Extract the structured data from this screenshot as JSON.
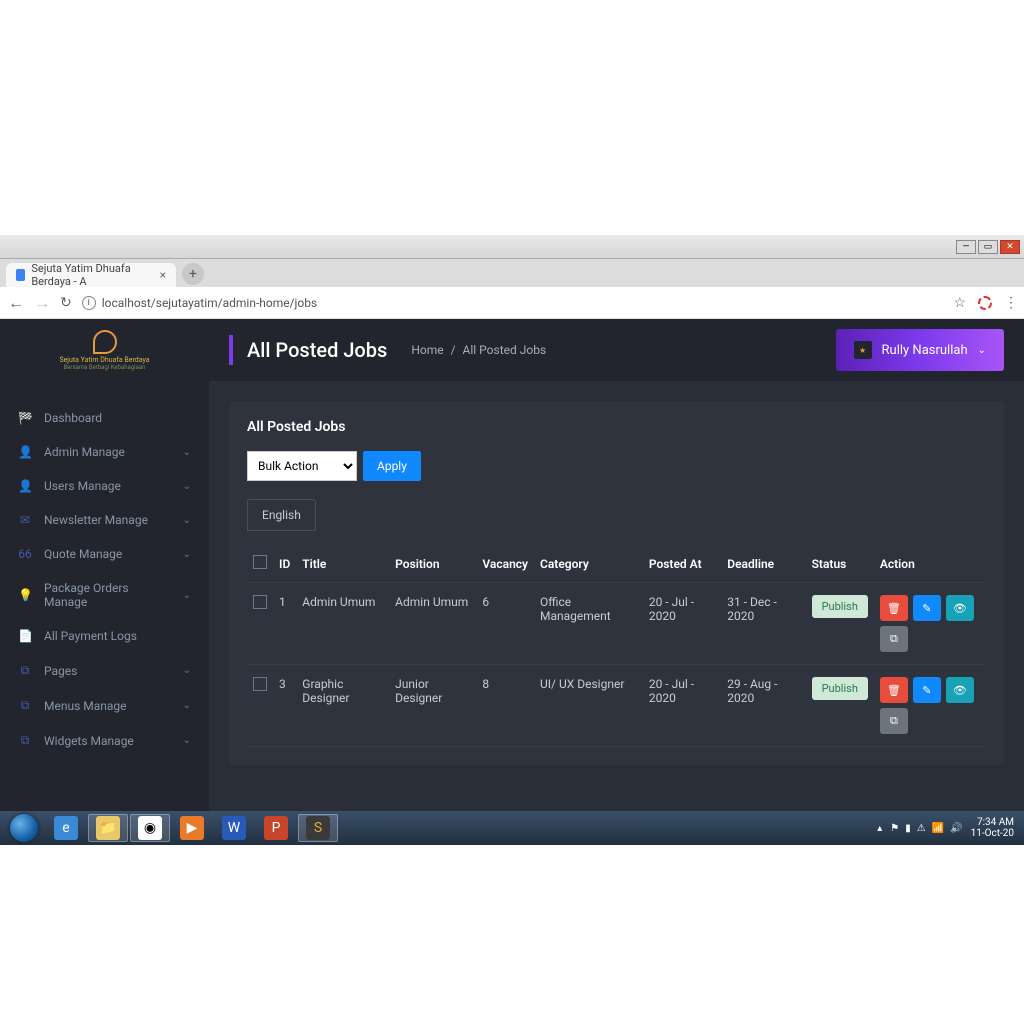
{
  "browser": {
    "tab_title": "Sejuta Yatim Dhuafa Berdaya - A",
    "url": "localhost/sejutayatim/admin-home/jobs"
  },
  "logo": {
    "line1": "Sejuta Yatim Dhuafa Berdaya",
    "line2": "Bersama Berbagi Kebahagiaan"
  },
  "sidebar": {
    "items": [
      {
        "icon": "speed-icon",
        "label": "Dashboard",
        "expandable": false
      },
      {
        "icon": "user-icon",
        "label": "Admin Manage",
        "expandable": true
      },
      {
        "icon": "user-icon",
        "label": "Users Manage",
        "expandable": true
      },
      {
        "icon": "mail-icon",
        "label": "Newsletter Manage",
        "expandable": true
      },
      {
        "icon": "quote-icon",
        "label": "Quote Manage",
        "expandable": true
      },
      {
        "icon": "bulb-icon",
        "label": "Package Orders Manage",
        "expandable": true
      },
      {
        "icon": "file-icon",
        "label": "All Payment Logs",
        "expandable": false
      },
      {
        "icon": "copy-icon",
        "label": "Pages",
        "expandable": true
      },
      {
        "icon": "copy-icon",
        "label": "Menus Manage",
        "expandable": true
      },
      {
        "icon": "copy-icon",
        "label": "Widgets Manage",
        "expandable": true
      }
    ]
  },
  "header": {
    "title": "All Posted Jobs",
    "breadcrumb_home": "Home",
    "breadcrumb_current": "All Posted Jobs",
    "user_name": "Rully Nasrullah"
  },
  "panel": {
    "title": "All Posted Jobs",
    "bulk_placeholder": "Bulk Action",
    "apply_label": "Apply",
    "lang_tab": "English"
  },
  "table": {
    "headers": {
      "id": "ID",
      "title": "Title",
      "position": "Position",
      "vacancy": "Vacancy",
      "category": "Category",
      "posted": "Posted At",
      "deadline": "Deadline",
      "status": "Status",
      "action": "Action"
    },
    "rows": [
      {
        "id": "1",
        "title": "Admin Umum",
        "position": "Admin Umum",
        "vacancy": "6",
        "category": "Office Management",
        "posted": "20 - Jul - 2020",
        "deadline": "31 - Dec - 2020",
        "status": "Publish"
      },
      {
        "id": "3",
        "title": "Graphic Designer",
        "position": "Junior Designer",
        "vacancy": "8",
        "category": "UI/ UX Designer",
        "posted": "20 - Jul - 2020",
        "deadline": "29 - Aug - 2020",
        "status": "Publish"
      }
    ]
  },
  "taskbar": {
    "time": "7:34 AM",
    "date": "11-Oct-20"
  }
}
